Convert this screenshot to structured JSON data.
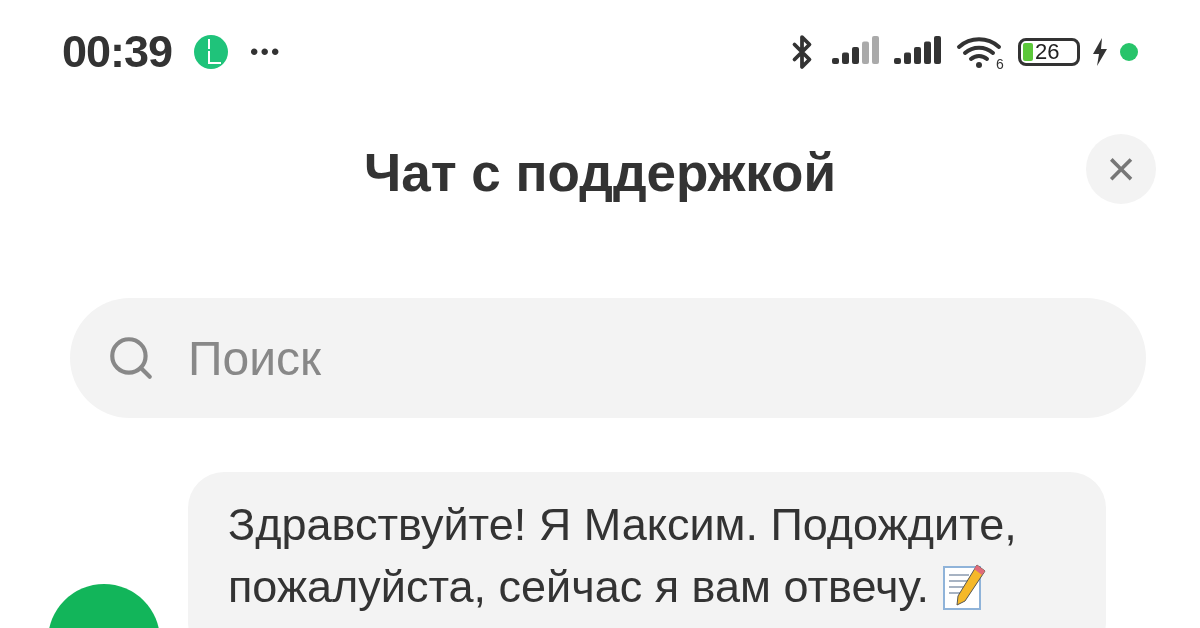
{
  "status_bar": {
    "time": "00:39",
    "more": "•••",
    "wifi_badge": "6",
    "battery": "26"
  },
  "header": {
    "title": "Чат с поддержкой",
    "close": "×"
  },
  "search": {
    "placeholder": "Поиск"
  },
  "messages": [
    {
      "lines": [
        "Здравствуйте! Я Максим. Подождите,",
        "пожалуйста, сейчас я вам отвечу."
      ]
    }
  ]
}
